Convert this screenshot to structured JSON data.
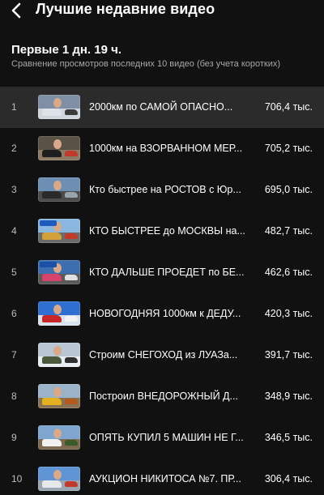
{
  "header": {
    "title": "Лучшие недавние видео"
  },
  "section": {
    "title": "Первые 1 дн. 19 ч.",
    "subtitle": "Сравнение просмотров последних 10 видео (без учета коротких)"
  },
  "videos": [
    {
      "rank": "1",
      "title": "2000км по САМОЙ ОПАСНО...",
      "views": "706,4 тыс.",
      "thumb": {
        "sky": "#7e8fa6",
        "ground": "#cfd6de",
        "car": "#dfe3e8",
        "car2": "#3a3a3a",
        "label": ""
      }
    },
    {
      "rank": "2",
      "title": "1000км на ВЗОРВАННОМ МЕР...",
      "views": "705,2 тыс.",
      "thumb": {
        "sky": "#5a5247",
        "ground": "#8c7a63",
        "car": "#1e1e1e",
        "car2": "#c0392b",
        "label": ""
      }
    },
    {
      "rank": "3",
      "title": "Кто быстрее на РОСТОВ с Юр...",
      "views": "695,0 тыс.",
      "thumb": {
        "sky": "#6d8fb3",
        "ground": "#4c4c4c",
        "car": "#2a2a2a",
        "car2": "#9aa4ad",
        "label": ""
      }
    },
    {
      "rank": "4",
      "title": "КТО БЫСТРЕЕ до МОСКВЫ на...",
      "views": "482,7 тыс.",
      "thumb": {
        "sky": "#8ab6e0",
        "ground": "#6b6b6b",
        "car": "#d3a13a",
        "car2": "#c23a2a",
        "label": "#1e5bbf"
      }
    },
    {
      "rank": "5",
      "title": "КТО ДАЛЬШЕ ПРОЕДЕТ по БЕ...",
      "views": "462,6 тыс.",
      "thumb": {
        "sky": "#3d6fb0",
        "ground": "#5a5a5a",
        "car": "#d8436a",
        "car2": "#e0e0e0",
        "label": "#1c4fa8"
      }
    },
    {
      "rank": "6",
      "title": "НОВОГОДНЯЯ 1000км к ДЕДУ...",
      "views": "420,3 тыс.",
      "thumb": {
        "sky": "#2f6fd1",
        "ground": "#d9e3ef",
        "car": "#c72727",
        "car2": "#f2f2f2",
        "label": ""
      }
    },
    {
      "rank": "7",
      "title": "Строим СНЕГОХОД из ЛУАЗа...",
      "views": "391,7 тыс.",
      "thumb": {
        "sky": "#b9c7d4",
        "ground": "#e9eef3",
        "car": "#4a5a3a",
        "car2": "#2f2f2f",
        "label": ""
      }
    },
    {
      "rank": "8",
      "title": "Построил ВНЕДОРОЖНЫЙ Д...",
      "views": "348,9 тыс.",
      "thumb": {
        "sky": "#9bb3c8",
        "ground": "#8a7355",
        "car": "#e3b21f",
        "car2": "#b55a1c",
        "label": ""
      }
    },
    {
      "rank": "9",
      "title": "ОПЯТЬ КУПИЛ 5 МАШИН НЕ Г...",
      "views": "346,5 тыс.",
      "thumb": {
        "sky": "#7ea6cf",
        "ground": "#7b6a50",
        "car": "#f0f0f0",
        "car2": "#3b5a2a",
        "label": ""
      }
    },
    {
      "rank": "10",
      "title": "АУКЦИОН НИКИТОСА №7. ПР...",
      "views": "306,4 тыс.",
      "thumb": {
        "sky": "#5f95d4",
        "ground": "#9aa6b2",
        "car": "#e8e8e8",
        "car2": "#c0392b",
        "label": ""
      }
    }
  ],
  "colors": {
    "background": "#111111",
    "highlight_row": "#2b2b2b",
    "secondary_text": "#a8a8a8"
  },
  "icons": {
    "back": "chevron-left-icon"
  }
}
